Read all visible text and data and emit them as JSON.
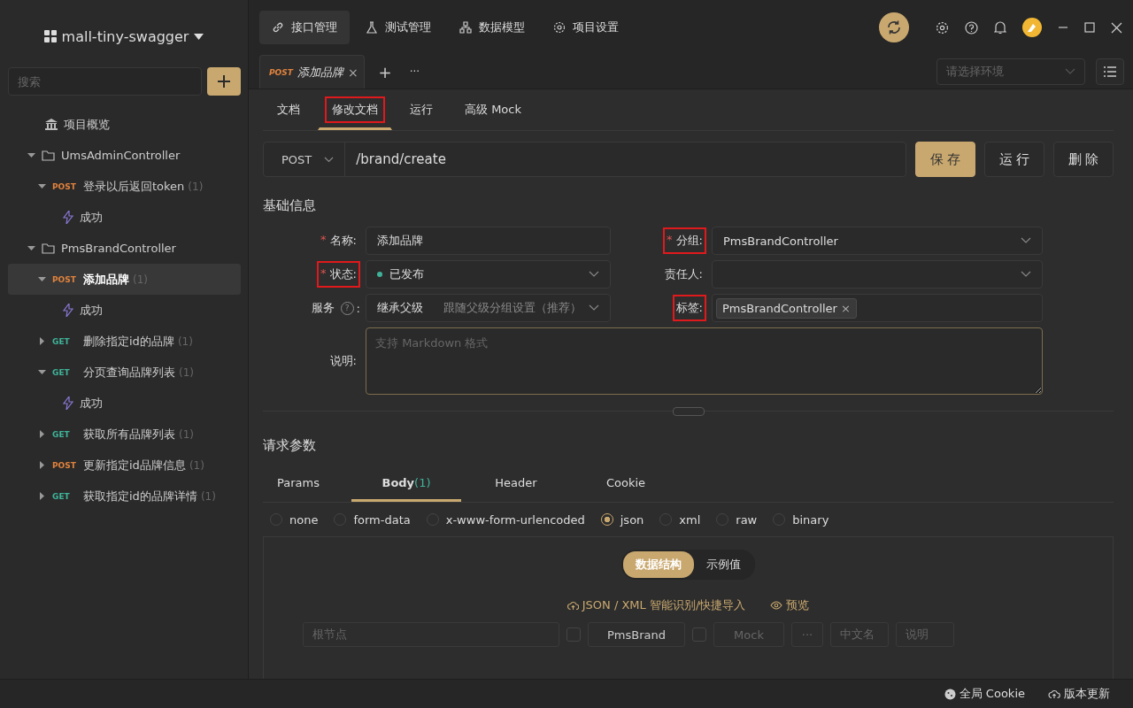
{
  "sidebar": {
    "project": "mall-tiny-swagger",
    "search": {
      "placeholder": "搜索"
    },
    "tree": [
      {
        "kind": "overview",
        "label": "项目概览"
      },
      {
        "kind": "folder",
        "label": "UmsAdminController",
        "expanded": true,
        "children": [
          {
            "kind": "endpoint",
            "method": "POST",
            "label": "登录以后返回token",
            "count": "(1)",
            "expanded": true,
            "selected": false,
            "children": [
              {
                "kind": "response",
                "label": "成功"
              }
            ]
          }
        ]
      },
      {
        "kind": "folder",
        "label": "PmsBrandController",
        "expanded": true,
        "children": [
          {
            "kind": "endpoint",
            "method": "POST",
            "label": "添加品牌",
            "count": "(1)",
            "expanded": true,
            "selected": true,
            "children": [
              {
                "kind": "response",
                "label": "成功"
              }
            ]
          },
          {
            "kind": "endpoint",
            "method": "GET",
            "label": "删除指定id的品牌",
            "count": "(1)",
            "expanded": false,
            "selected": false
          },
          {
            "kind": "endpoint",
            "method": "GET",
            "label": "分页查询品牌列表",
            "count": "(1)",
            "expanded": true,
            "selected": false,
            "children": [
              {
                "kind": "response",
                "label": "成功"
              }
            ]
          },
          {
            "kind": "endpoint",
            "method": "GET",
            "label": "获取所有品牌列表",
            "count": "(1)",
            "expanded": false,
            "selected": false
          },
          {
            "kind": "endpoint",
            "method": "POST",
            "label": "更新指定id品牌信息",
            "count": "(1)",
            "expanded": false,
            "selected": false
          },
          {
            "kind": "endpoint",
            "method": "GET",
            "label": "获取指定id的品牌详情",
            "count": "(1)",
            "expanded": false,
            "selected": false
          }
        ]
      }
    ]
  },
  "nav": {
    "tabs": [
      {
        "kind": "link",
        "label": "接口管理",
        "selected": true
      },
      {
        "kind": "flask",
        "label": "测试管理",
        "selected": false
      },
      {
        "kind": "model",
        "label": "数据模型",
        "selected": false
      },
      {
        "kind": "gear",
        "label": "项目设置",
        "selected": false
      }
    ]
  },
  "doc_tab": {
    "method": "POST",
    "title": "添加品牌",
    "close": "×",
    "add": "+",
    "more": "···"
  },
  "environment": {
    "placeholder": "请选择环境"
  },
  "sub_tabs": [
    {
      "label": "文档",
      "selected": false,
      "highlighted": false
    },
    {
      "label": "修改文档",
      "selected": true,
      "highlighted": true
    },
    {
      "label": "运行",
      "selected": false,
      "highlighted": false
    },
    {
      "label": "高级 Mock",
      "selected": false,
      "highlighted": false
    }
  ],
  "request": {
    "method": "POST",
    "path": "/brand/create"
  },
  "buttons": [
    {
      "label": "保 存",
      "primary": true
    },
    {
      "label": "运 行",
      "primary": false
    },
    {
      "label": "删 除",
      "primary": false
    }
  ],
  "basic": {
    "title": "基础信息",
    "rows": [
      [
        {
          "kind": "text",
          "required_mark": "*",
          "label": "名称:",
          "highlighted": false,
          "value": "添加品牌"
        },
        {
          "kind": "select",
          "required_mark": "*",
          "label": "分组:",
          "highlighted": true,
          "value": "PmsBrandController"
        }
      ],
      [
        {
          "kind": "status",
          "required_mark": "*",
          "label": "状态:",
          "highlighted": true,
          "value": "已发布",
          "color": "#3fb39a"
        },
        {
          "kind": "select",
          "label": "责任人:",
          "highlighted": false
        }
      ],
      [
        {
          "kind": "service",
          "label": "服务",
          "help": "?",
          "colon": ":",
          "highlighted": false,
          "value": "继承父级",
          "hint": "跟随父级分组设置（推荐）"
        },
        {
          "kind": "tags",
          "label": "标签:",
          "highlighted": true,
          "tags": [
            {
              "label": "PmsBrandController",
              "remove": "×"
            }
          ]
        }
      ]
    ],
    "description": {
      "label": "说明:",
      "placeholder": "支持 Markdown 格式"
    }
  },
  "params": {
    "title": "请求参数",
    "tabs": [
      {
        "label": "Params",
        "selected": false
      },
      {
        "label": "Body",
        "count": "(1)",
        "selected": true
      },
      {
        "label": "Header",
        "selected": false
      },
      {
        "label": "Cookie",
        "selected": false
      }
    ],
    "body_types": [
      {
        "label": "none",
        "selected": false
      },
      {
        "label": "form-data",
        "selected": false
      },
      {
        "label": "x-www-form-urlencoded",
        "selected": false
      },
      {
        "label": "json",
        "selected": true
      },
      {
        "label": "xml",
        "selected": false
      },
      {
        "label": "raw",
        "selected": false
      },
      {
        "label": "binary",
        "selected": false
      }
    ],
    "modes": [
      {
        "label": "数据结构",
        "selected": true
      },
      {
        "label": "示例值",
        "selected": false
      }
    ],
    "actions": [
      {
        "kind": "cloud",
        "label": "JSON / XML 智能识别/快捷导入"
      },
      {
        "kind": "eye",
        "label": "预览"
      }
    ],
    "root_row": {
      "name": "根节点",
      "required_checked": false,
      "type": "PmsBrand",
      "nullable_checked": false,
      "mock": "Mock",
      "more": "···",
      "title": "中文名",
      "description": "说明"
    }
  },
  "status_bar": [
    {
      "kind": "cookie",
      "label": "全局 Cookie"
    },
    {
      "kind": "update",
      "label": "版本更新"
    }
  ]
}
